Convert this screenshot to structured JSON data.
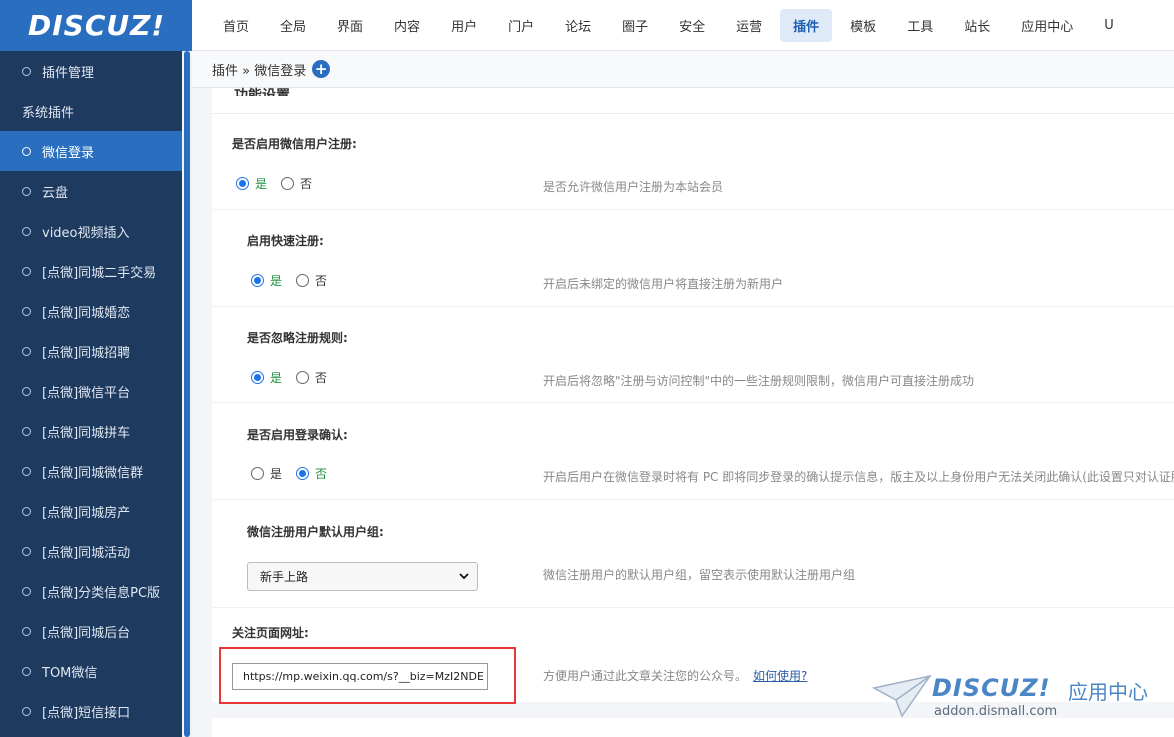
{
  "logo": "DISCUZ!",
  "topnav": [
    "首页",
    "全局",
    "界面",
    "内容",
    "用户",
    "门户",
    "论坛",
    "圈子",
    "安全",
    "运营",
    "插件",
    "模板",
    "工具",
    "站长",
    "应用中心",
    "U"
  ],
  "topnav_active": "插件",
  "sidebar": {
    "items": [
      {
        "label": "插件管理",
        "dot": true,
        "active": false
      },
      {
        "label": "系统插件",
        "dot": false,
        "active": false
      },
      {
        "label": "微信登录",
        "dot": true,
        "active": true
      },
      {
        "label": "云盘",
        "dot": true,
        "active": false
      },
      {
        "label": "video视频插入",
        "dot": true,
        "active": false
      },
      {
        "label": "[点微]同城二手交易",
        "dot": true,
        "active": false
      },
      {
        "label": "[点微]同城婚恋",
        "dot": true,
        "active": false
      },
      {
        "label": "[点微]同城招聘",
        "dot": true,
        "active": false
      },
      {
        "label": "[点微]微信平台",
        "dot": true,
        "active": false
      },
      {
        "label": "[点微]同城拼车",
        "dot": true,
        "active": false
      },
      {
        "label": "[点微]同城微信群",
        "dot": true,
        "active": false
      },
      {
        "label": "[点微]同城房产",
        "dot": true,
        "active": false
      },
      {
        "label": "[点微]同城活动",
        "dot": true,
        "active": false
      },
      {
        "label": "[点微]分类信息PC版",
        "dot": true,
        "active": false
      },
      {
        "label": "[点微]同城后台",
        "dot": true,
        "active": false
      },
      {
        "label": "TOM微信",
        "dot": true,
        "active": false
      },
      {
        "label": "[点微]短信接口",
        "dot": true,
        "active": false
      }
    ]
  },
  "breadcrumb": {
    "text": "插件 » 微信登录",
    "plus": "+"
  },
  "panel": {
    "title": "功能设置",
    "settings": [
      {
        "label": "是否启用微信用户注册:",
        "yes": "是",
        "no": "否",
        "selected": "yes",
        "desc": "是否允许微信用户注册为本站会员"
      },
      {
        "label": "启用快速注册:",
        "yes": "是",
        "no": "否",
        "selected": "yes",
        "desc": "开启后未绑定的微信用户将直接注册为新用户"
      },
      {
        "label": "是否忽略注册规则:",
        "yes": "是",
        "no": "否",
        "selected": "yes",
        "desc": "开启后将忽略\"注册与访问控制\"中的一些注册规则限制，微信用户可直接注册成功"
      },
      {
        "label": "是否启用登录确认:",
        "yes": "是",
        "no": "否",
        "selected": "no",
        "desc": "开启后用户在微信登录时将有 PC 即将同步登录的确认提示信息，版主及以上身份用户无法关闭此确认(此设置只对认证服"
      }
    ],
    "group": {
      "label": "微信注册用户默认用户组:",
      "value": "新手上路",
      "desc": "微信注册用户的默认用户组，留空表示使用默认注册用户组"
    },
    "follow": {
      "label": "关注页面网址:",
      "value": "https://mp.weixin.qq.com/s?__biz=MzI2NDE",
      "desc": "方便用户通过此文章关注您的公众号。",
      "link": "如何使用?"
    }
  },
  "watermark": {
    "brand": "DISCUZ!",
    "cn": "应用中心",
    "url": "addon.dismall.com"
  }
}
